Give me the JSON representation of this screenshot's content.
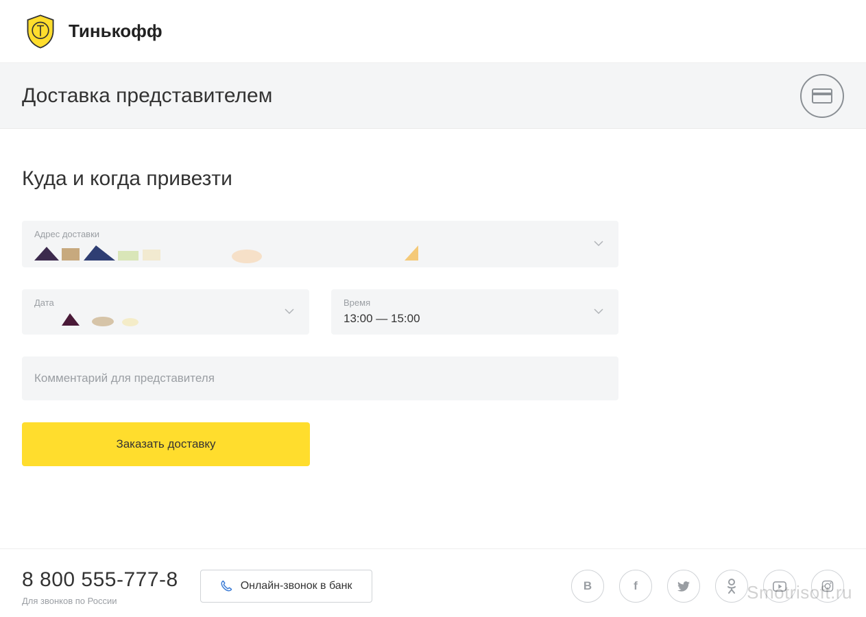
{
  "brand": {
    "name": "Тинькофф"
  },
  "page": {
    "title": "Доставка представителем"
  },
  "section": {
    "heading": "Куда и когда привезти"
  },
  "form": {
    "address_label": "Адрес доставки",
    "date_label": "Дата",
    "time_label": "Время",
    "time_value": "13:00 — 15:00",
    "comment_placeholder": "Комментарий для представителя",
    "submit_label": "Заказать доставку"
  },
  "footer": {
    "phone": "8 800 555-777-8",
    "phone_note": "Для звонков по России",
    "call_label": "Онлайн-звонок в банк"
  },
  "social": {
    "vk": "В",
    "fb": "f",
    "ok": "ok"
  },
  "watermark": "Smotrisoft.ru"
}
